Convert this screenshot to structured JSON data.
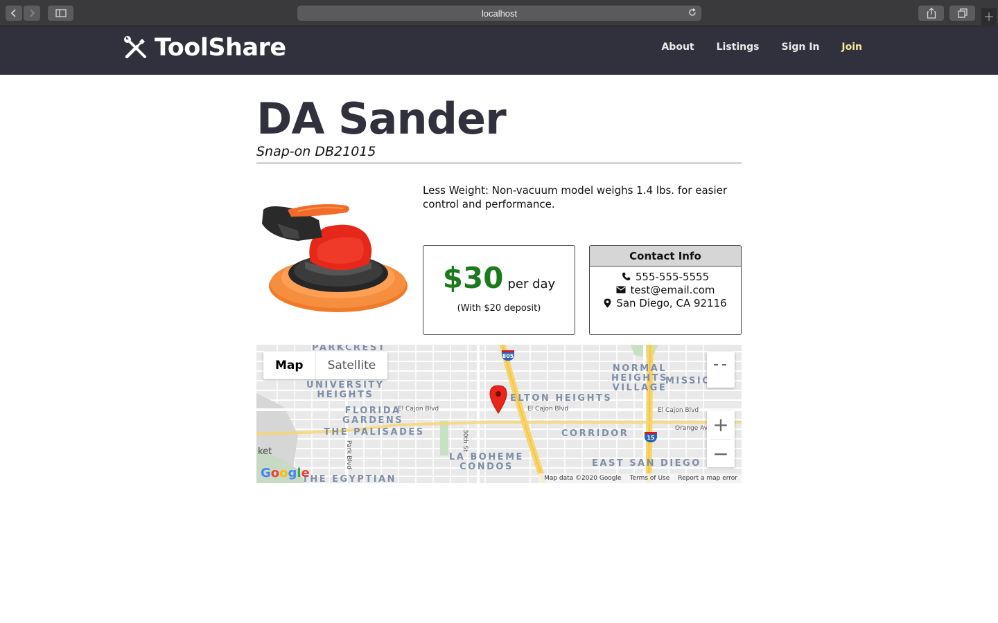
{
  "browser": {
    "url": "localhost"
  },
  "header": {
    "brand": "ToolShare",
    "nav": {
      "about": "About",
      "listings": "Listings",
      "sign_in": "Sign In",
      "join": "Join"
    }
  },
  "listing": {
    "title": "DA Sander",
    "model": "Snap-on DB21015",
    "description": "Less Weight: Non-vacuum model weighs 1.4 lbs. for easier control and performance.",
    "price": "$30",
    "price_unit": "per day",
    "deposit": "(With $20 deposit)"
  },
  "contact": {
    "heading": "Contact Info",
    "phone": "555-555-5555",
    "email": "test@email.com",
    "location": "San Diego, CA 92116"
  },
  "map": {
    "type_map": "Map",
    "type_satellite": "Satellite",
    "zoom_in": "+",
    "zoom_out": "−",
    "neighborhoods": {
      "parkcrest": "PARKCREST",
      "university_heights": "UNIVERSITY\nHEIGHTS",
      "florida_gardens": "FLORIDA\nGARDENS",
      "the_palisades": "THE PALISADES",
      "la_boheme": "LA BOHEME\nCONDOS",
      "the_egyptian": "THE EGYPTIAN",
      "elton_heights": "ELTON HEIGHTS",
      "normal_heights": "NORMAL\nHEIGHTS\nVILLAGE",
      "mission": "MISSIO",
      "corridor": "CORRIDOR",
      "east_san_diego": "EAST SAN DIEGO",
      "ket": "ket"
    },
    "streets": {
      "el_cajon_1": "El Cajon Blvd",
      "el_cajon_2": "El Cajon Blvd",
      "el_cajon_3": "El Cajon Blvd",
      "orange_av": "Orange Av",
      "thirtieth": "30th St",
      "park_blvd": "Park Blvd"
    },
    "shields": {
      "i805": "805",
      "i15": "15"
    },
    "footer": {
      "data": "Map data ©2020 Google",
      "terms": "Terms of Use",
      "report": "Report a map error"
    },
    "google_logo": "Google"
  },
  "colors": {
    "header_bg": "#30313d",
    "price_green": "#1b7a1b",
    "join_yellow": "#f6e99a"
  }
}
